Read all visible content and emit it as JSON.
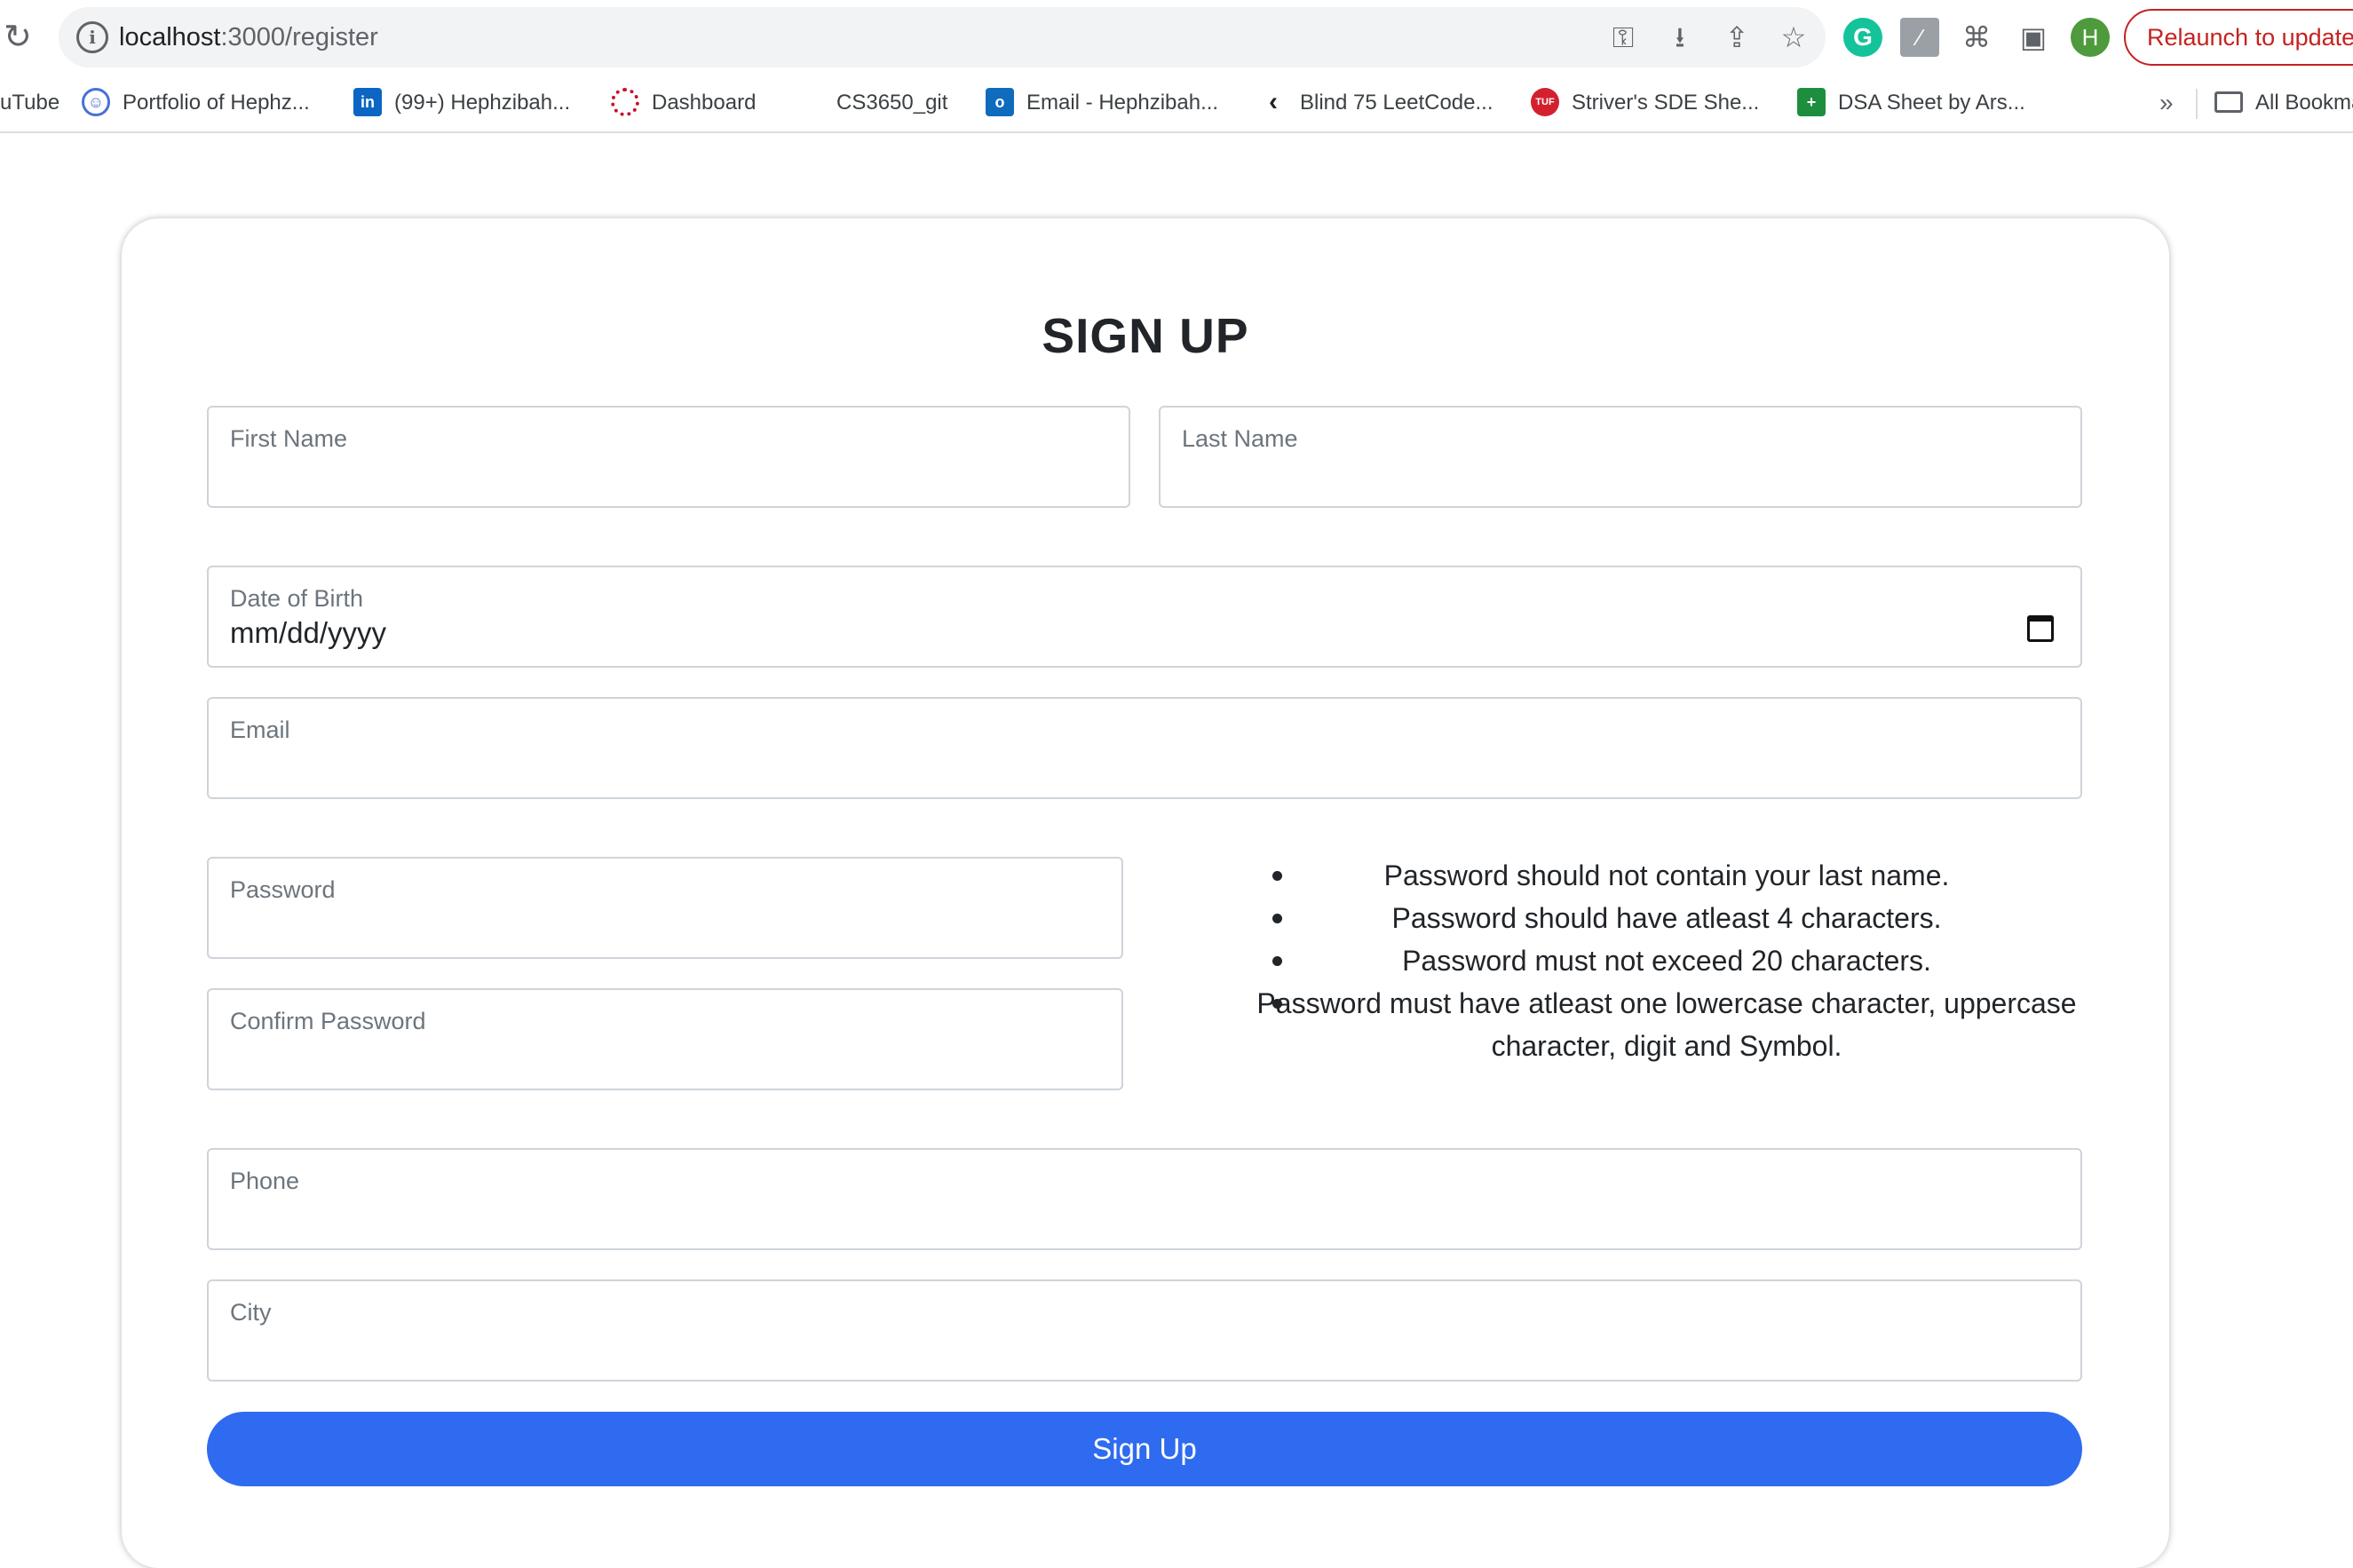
{
  "browser": {
    "url_host": "localhost",
    "url_path": ":3000/register",
    "relaunch_label": "Relaunch to update",
    "profile_initial": "H",
    "bookmarks": [
      {
        "label": "uTube"
      },
      {
        "label": "Portfolio of Hephz..."
      },
      {
        "label": "(99+) Hephzibah..."
      },
      {
        "label": "Dashboard"
      },
      {
        "label": "CS3650_git"
      },
      {
        "label": "Email - Hephzibah..."
      },
      {
        "label": "Blind 75 LeetCode..."
      },
      {
        "label": "Striver's SDE She..."
      },
      {
        "label": "DSA Sheet by Ars..."
      }
    ],
    "more_bookmarks": "»",
    "all_bookmarks": "All Bookmarks"
  },
  "form": {
    "title": "SIGN UP",
    "first_name_label": "First Name",
    "last_name_label": "Last Name",
    "dob_label": "Date of Birth",
    "dob_value": "mm/dd/yyyy",
    "email_label": "Email",
    "password_label": "Password",
    "confirm_password_label": "Confirm Password",
    "phone_label": "Phone",
    "city_label": "City",
    "password_rules": [
      "Password should not contain your last name.",
      "Password should have atleast 4 characters.",
      "Password must not exceed 20 characters.",
      "Password must have atleast one lowercase character, uppercase character, digit and Symbol."
    ],
    "submit_label": "Sign Up"
  },
  "colors": {
    "primary_button": "#2f6bf0",
    "relaunch": "#c5221f",
    "input_border": "#ced4da"
  }
}
